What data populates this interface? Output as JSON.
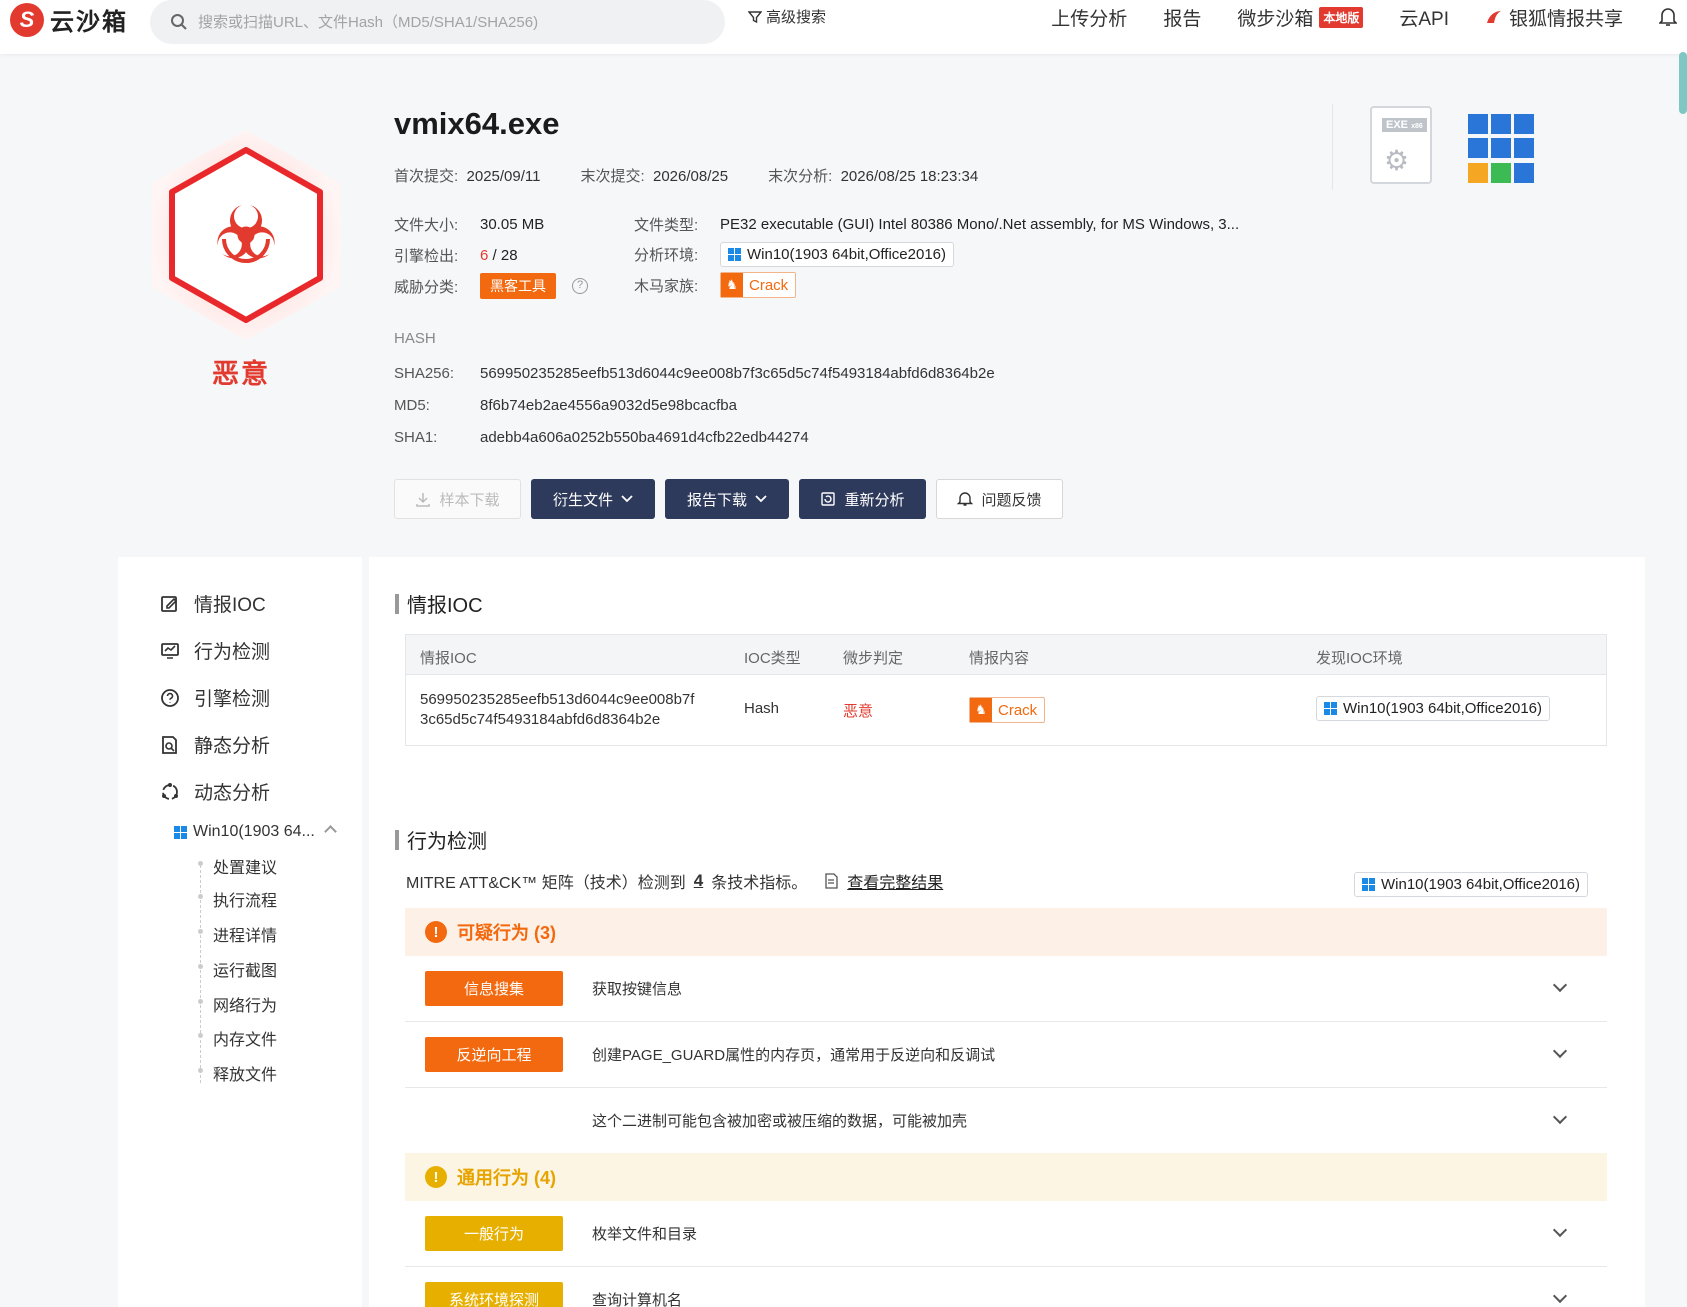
{
  "topbar": {
    "logo_text": "云沙箱",
    "search_placeholder": "搜索或扫描URL、文件Hash（MD5/SHA1/SHA256)",
    "advanced_search": "高级搜索",
    "nav": [
      "上传分析",
      "报告",
      "微步沙箱",
      "云API",
      "银狐情报共享"
    ],
    "nav_badge": "本地版"
  },
  "verdict": {
    "label": "恶意",
    "color": "#e23a2e",
    "icon": "biohazard-icon"
  },
  "file": {
    "name": "vmix64.exe",
    "first_submit_label": "首次提交:",
    "first_submit": "2025/09/11",
    "last_submit_label": "末次提交:",
    "last_submit": "2026/08/25",
    "last_analysis_label": "末次分析:",
    "last_analysis": "2026/08/25 18:23:34",
    "size_label": "文件大小:",
    "size": "30.05 MB",
    "type_label": "文件类型:",
    "type": "PE32 executable (GUI) Intel 80386 Mono/.Net assembly, for MS Windows, 3...",
    "engine_label": "引擎检出:",
    "engine_detected": "6",
    "engine_total": "/ 28",
    "env_label": "分析环境:",
    "env": "Win10(1903 64bit,Office2016)",
    "threat_label": "威胁分类:",
    "threat": "黑客工具",
    "family_label": "木马家族:",
    "family": "Crack"
  },
  "hash": {
    "title": "HASH",
    "sha256_label": "SHA256:",
    "sha256": "569950235285eefb513d6044c9ee008b7f3c65d5c74f5493184abfd6d8364b2e",
    "md5_label": "MD5:",
    "md5": "8f6b74eb2ae4556a9032d5e98bcacfba",
    "sha1_label": "SHA1:",
    "sha1": "adebb4a606a0252b550ba4691d4cfb22edb44274"
  },
  "buttons": {
    "download_sample": "样本下载",
    "derived_files": "衍生文件",
    "report_download": "报告下载",
    "reanalyze": "重新分析",
    "feedback": "问题反馈"
  },
  "file_icons": {
    "exe_tag": "EXE",
    "exe_sub": "x86"
  },
  "sidebar": {
    "items": [
      "情报IOC",
      "行为检测",
      "引擎检测",
      "静态分析",
      "动态分析"
    ],
    "env_short": "Win10(1903 64...",
    "sub_items": [
      "处置建议",
      "执行流程",
      "进程详情",
      "运行截图",
      "网络行为",
      "内存文件",
      "释放文件"
    ]
  },
  "ioc": {
    "title": "情报IOC",
    "headers": [
      "情报IOC",
      "IOC类型",
      "微步判定",
      "情报内容",
      "发现IOC环境"
    ],
    "row": {
      "ioc_line1": "569950235285eefb513d6044c9ee008b7f",
      "ioc_line2": "3c65d5c74f5493184abfd6d8364b2e",
      "type": "Hash",
      "verdict": "恶意",
      "content": "Crack",
      "env": "Win10(1903 64bit,Office2016)"
    }
  },
  "behavior": {
    "title": "行为检测",
    "mitre_prefix": "MITRE ATT&CK™ 矩阵（技术）检测到",
    "mitre_count": "4",
    "mitre_suffix": "条技术指标。",
    "full_result": "查看完整结果",
    "env": "Win10(1903 64bit,Office2016)",
    "suspicious_title": "可疑行为 (3)",
    "general_title": "通用行为 (4)",
    "suspicious_rows": [
      {
        "tag": "信息搜集",
        "desc": "获取按键信息"
      },
      {
        "tag": "反逆向工程",
        "desc": "创建PAGE_GUARD属性的内存页，通常用于反逆向和反调试"
      },
      {
        "tag": "",
        "desc": "这个二进制可能包含被加密或被压缩的数据，可能被加壳"
      }
    ],
    "general_rows": [
      {
        "tag": "一般行为",
        "desc": "枚举文件和目录"
      },
      {
        "tag": "系统环境探测",
        "desc": "查询计算机名"
      }
    ],
    "colors": {
      "suspicious": "#f2690f",
      "general": "#e7b000"
    }
  }
}
